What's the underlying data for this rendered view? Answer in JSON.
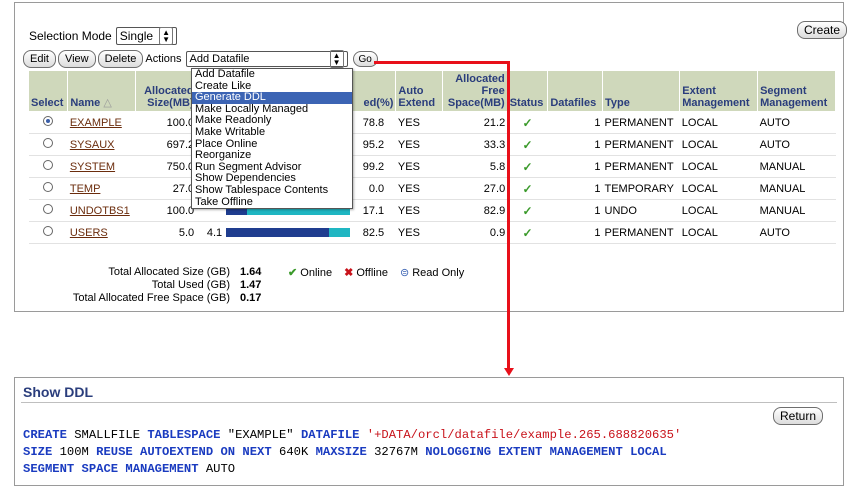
{
  "top": {
    "selection_mode_label": "Selection Mode",
    "selection_mode_value": "Single",
    "create_label": "Create"
  },
  "toolbar": {
    "edit_label": "Edit",
    "view_label": "View",
    "delete_label": "Delete",
    "actions_label": "Actions",
    "actions_value": "Add Datafile",
    "go_label": "Go"
  },
  "actions_menu": [
    "Add Datafile",
    "Create Like",
    "Generate DDL",
    "Make Locally Managed",
    "Make Readonly",
    "Make Writable",
    "Place Online",
    "Reorganize",
    "Run Segment Advisor",
    "Show Dependencies",
    "Show Tablespace Contents",
    "Take Offline"
  ],
  "table": {
    "headers": {
      "select": "Select",
      "name": "Name",
      "allocated_size": "Allocated Size(MB)",
      "used_pct": "ed(%)",
      "auto_extend": "Auto Extend",
      "allocated_free": "Allocated Free Space(MB)",
      "status": "Status",
      "datafiles": "Datafiles",
      "type": "Type",
      "extent_mgmt": "Extent Management",
      "segment_mgmt": "Segment Management"
    },
    "rows": [
      {
        "name": "EXAMPLE",
        "size": "100.0",
        "used": "",
        "used_fraction": 0.788,
        "pct": "78.8",
        "auto": "YES",
        "free": "21.2",
        "datafiles": "1",
        "type": "PERMANENT",
        "extent": "LOCAL",
        "segment": "AUTO"
      },
      {
        "name": "SYSAUX",
        "size": "697.2",
        "used": "",
        "used_fraction": 0.952,
        "pct": "95.2",
        "auto": "YES",
        "free": "33.3",
        "datafiles": "1",
        "type": "PERMANENT",
        "extent": "LOCAL",
        "segment": "AUTO"
      },
      {
        "name": "SYSTEM",
        "size": "750.0",
        "used": "",
        "used_fraction": 0.992,
        "pct": "99.2",
        "auto": "YES",
        "free": "5.8",
        "datafiles": "1",
        "type": "PERMANENT",
        "extent": "LOCAL",
        "segment": "MANUAL"
      },
      {
        "name": "TEMP",
        "size": "27.0",
        "used": "",
        "used_fraction": 0.0,
        "pct": "0.0",
        "auto": "YES",
        "free": "27.0",
        "datafiles": "1",
        "type": "TEMPORARY",
        "extent": "LOCAL",
        "segment": "MANUAL"
      },
      {
        "name": "UNDOTBS1",
        "size": "100.0",
        "used": "",
        "used_fraction": 0.171,
        "pct": "17.1",
        "auto": "YES",
        "free": "82.9",
        "datafiles": "1",
        "type": "UNDO",
        "extent": "LOCAL",
        "segment": "MANUAL"
      },
      {
        "name": "USERS",
        "size": "5.0",
        "used": "4.1",
        "used_fraction": 0.825,
        "pct": "82.5",
        "auto": "YES",
        "free": "0.9",
        "datafiles": "1",
        "type": "PERMANENT",
        "extent": "LOCAL",
        "segment": "AUTO"
      }
    ]
  },
  "totals": {
    "allocated_label": "Total Allocated Size (GB)",
    "allocated_value": "1.64",
    "used_label": "Total Used (GB)",
    "used_value": "1.47",
    "free_label": "Total Allocated Free Space (GB)",
    "free_value": "0.17"
  },
  "legend": {
    "online": "Online",
    "offline": "Offline",
    "readonly": "Read Only"
  },
  "ddl": {
    "title": "Show DDL",
    "return_label": "Return"
  },
  "colors": {
    "header_bg": "#cfd8bb",
    "header_text": "#2a3d7c",
    "used_bar": "#1f3d8f",
    "free_bar": "#1fb6c2",
    "arrow": "#e8101a",
    "keyword": "#1a3bc0",
    "string": "#c8121a"
  }
}
